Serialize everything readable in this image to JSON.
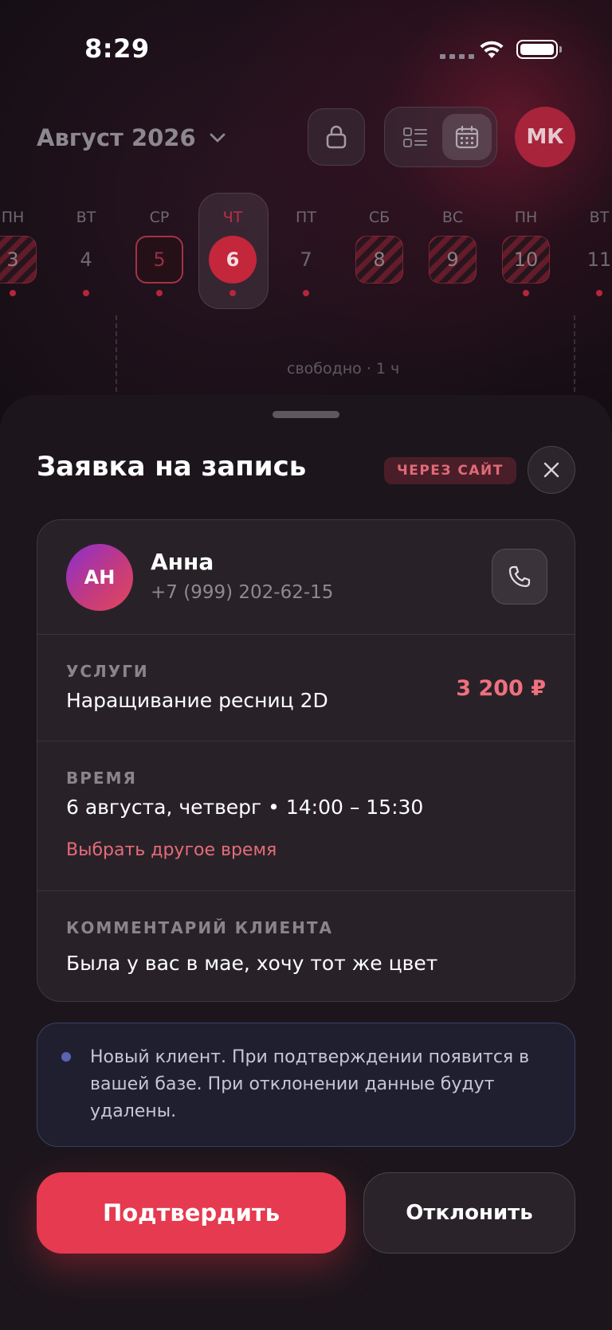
{
  "status_bar": {
    "time": "8:29"
  },
  "header": {
    "month": "Август 2026",
    "avatar_initials": "МК"
  },
  "week": [
    {
      "name": "ПН",
      "num": "3",
      "style": "hatch",
      "dot": true
    },
    {
      "name": "ВТ",
      "num": "4",
      "style": "plain",
      "dot": true
    },
    {
      "name": "СР",
      "num": "5",
      "style": "outlined",
      "dot": true
    },
    {
      "name": "ЧТ",
      "num": "6",
      "style": "today",
      "dot": true
    },
    {
      "name": "ПТ",
      "num": "7",
      "style": "plain",
      "dot": true
    },
    {
      "name": "СБ",
      "num": "8",
      "style": "hatch",
      "dot": false
    },
    {
      "name": "ВС",
      "num": "9",
      "style": "hatch",
      "dot": false
    },
    {
      "name": "ПН",
      "num": "10",
      "style": "hatch",
      "dot": true
    },
    {
      "name": "ВТ",
      "num": "11",
      "style": "plain",
      "dot": true
    }
  ],
  "timeline": {
    "free_label": "свободно · 1 ч"
  },
  "sheet": {
    "title": "Заявка на запись",
    "source_badge": "ЧЕРЕЗ САЙТ",
    "client": {
      "initials": "АН",
      "name": "Анна",
      "phone": "+7 (999) 202-62-15"
    },
    "services": {
      "label": "УСЛУГИ",
      "value": "Наращивание ресниц 2D",
      "price": "3 200 ₽"
    },
    "time": {
      "label": "ВРЕМЯ",
      "value": "6 августа, четверг • 14:00 – 15:30",
      "change_link": "Выбрать другое время"
    },
    "comment": {
      "label": "КОММЕНТАРИЙ КЛИЕНТА",
      "value": "Была у вас в мае, хочу тот же цвет"
    },
    "notice": "Новый клиент. При подтверждении появится в вашей базе. При отклонении данные будут удалены.",
    "confirm_label": "Подтвердить",
    "decline_label": "Отклонить"
  },
  "colors": {
    "accent": "#e53a4f",
    "background": "#140e14",
    "sheet": "#1c161c",
    "card": "#282228"
  }
}
